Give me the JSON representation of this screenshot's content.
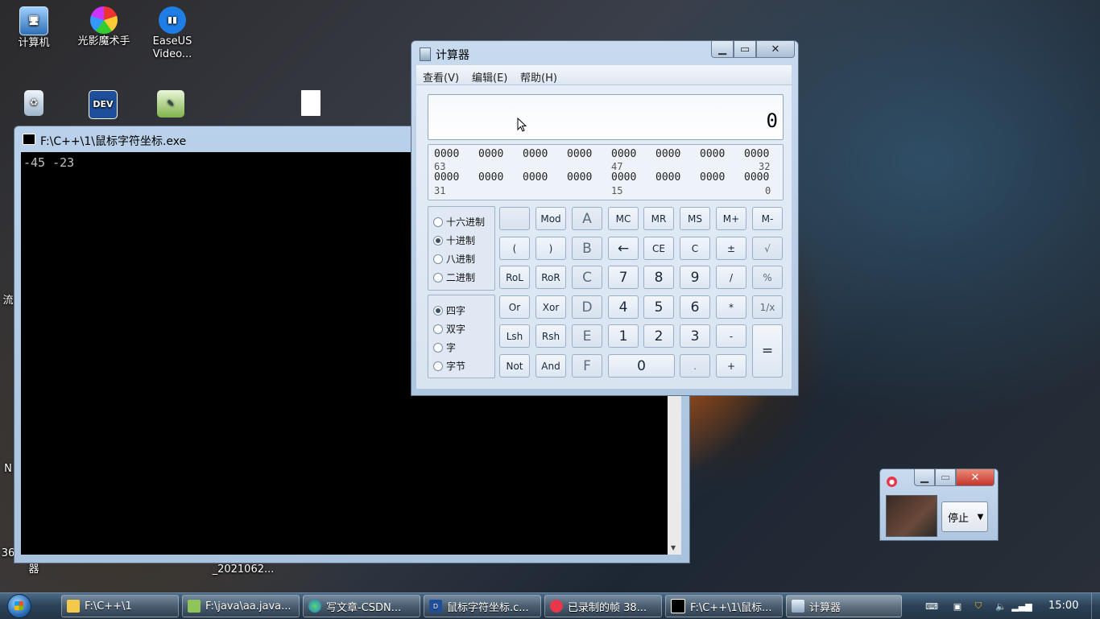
{
  "desktop": {
    "icons": [
      {
        "label": "计算机",
        "icon": "computer-icon"
      },
      {
        "label": "光影魔术手",
        "icon": "app-icon"
      },
      {
        "label": "EaseUS Video...",
        "icon": "easeus-icon"
      },
      {
        "label": "",
        "icon": "recycle-bin-icon"
      },
      {
        "label": "",
        "icon": "dev-cpp-icon"
      },
      {
        "label": "",
        "icon": "notepad-icon"
      },
      {
        "label": "",
        "icon": "blank-file-icon"
      }
    ],
    "partial_labels": [
      "器",
      "_2021062..."
    ],
    "edge_texts": [
      "流",
      "N",
      "36"
    ]
  },
  "console": {
    "title": "F:\\C++\\1\\鼠标字符坐标.exe",
    "output": "-45 -23"
  },
  "calculator": {
    "title": "计算器",
    "menu": [
      "查看(V)",
      "编辑(E)",
      "帮助(H)"
    ],
    "display": "0",
    "bits_row1": [
      "0000",
      "0000",
      "0000",
      "0000",
      "0000",
      "0000",
      "0000",
      "0000"
    ],
    "bits_row2": [
      "0000",
      "0000",
      "0000",
      "0000",
      "0000",
      "0000",
      "0000",
      "0000"
    ],
    "bit_positions_row1": [
      "63",
      "47",
      "32"
    ],
    "bit_positions_row2": [
      "31",
      "15",
      "0"
    ],
    "base_options": [
      "十六进制",
      "十进制",
      "八进制",
      "二进制"
    ],
    "base_selected": "十进制",
    "word_options": [
      "四字",
      "双字",
      "字",
      "字节"
    ],
    "word_selected": "四字",
    "keys": {
      "r1": [
        "",
        "Mod",
        "A",
        "MC",
        "MR",
        "MS",
        "M+",
        "M-"
      ],
      "r2": [
        "(",
        ")",
        "B",
        "←",
        "CE",
        "C",
        "±",
        "√"
      ],
      "r3": [
        "RoL",
        "RoR",
        "C",
        "7",
        "8",
        "9",
        "/",
        "%"
      ],
      "r4": [
        "Or",
        "Xor",
        "D",
        "4",
        "5",
        "6",
        "*",
        "1/x"
      ],
      "r5": [
        "Lsh",
        "Rsh",
        "E",
        "1",
        "2",
        "3",
        "-",
        "="
      ],
      "r6": [
        "Not",
        "And",
        "F",
        "0",
        ".",
        "+"
      ]
    }
  },
  "recorder": {
    "stop_label": "停止",
    "dropdown": "▼"
  },
  "taskbar": {
    "tasks": [
      {
        "label": "F:\\C++\\1",
        "icon": "folder-icon"
      },
      {
        "label": "F:\\java\\aa.java...",
        "icon": "notepad-icon"
      },
      {
        "label": "写文章-CSDN...",
        "icon": "edge-icon"
      },
      {
        "label": "鼠标字符坐标.c...",
        "icon": "dev-cpp-icon"
      },
      {
        "label": "已录制的帧 38...",
        "icon": "recorder-icon"
      },
      {
        "label": "F:\\C++\\1\\鼠标...",
        "icon": "console-icon"
      },
      {
        "label": "计算器",
        "icon": "calculator-icon"
      }
    ],
    "clock": "15:00"
  }
}
